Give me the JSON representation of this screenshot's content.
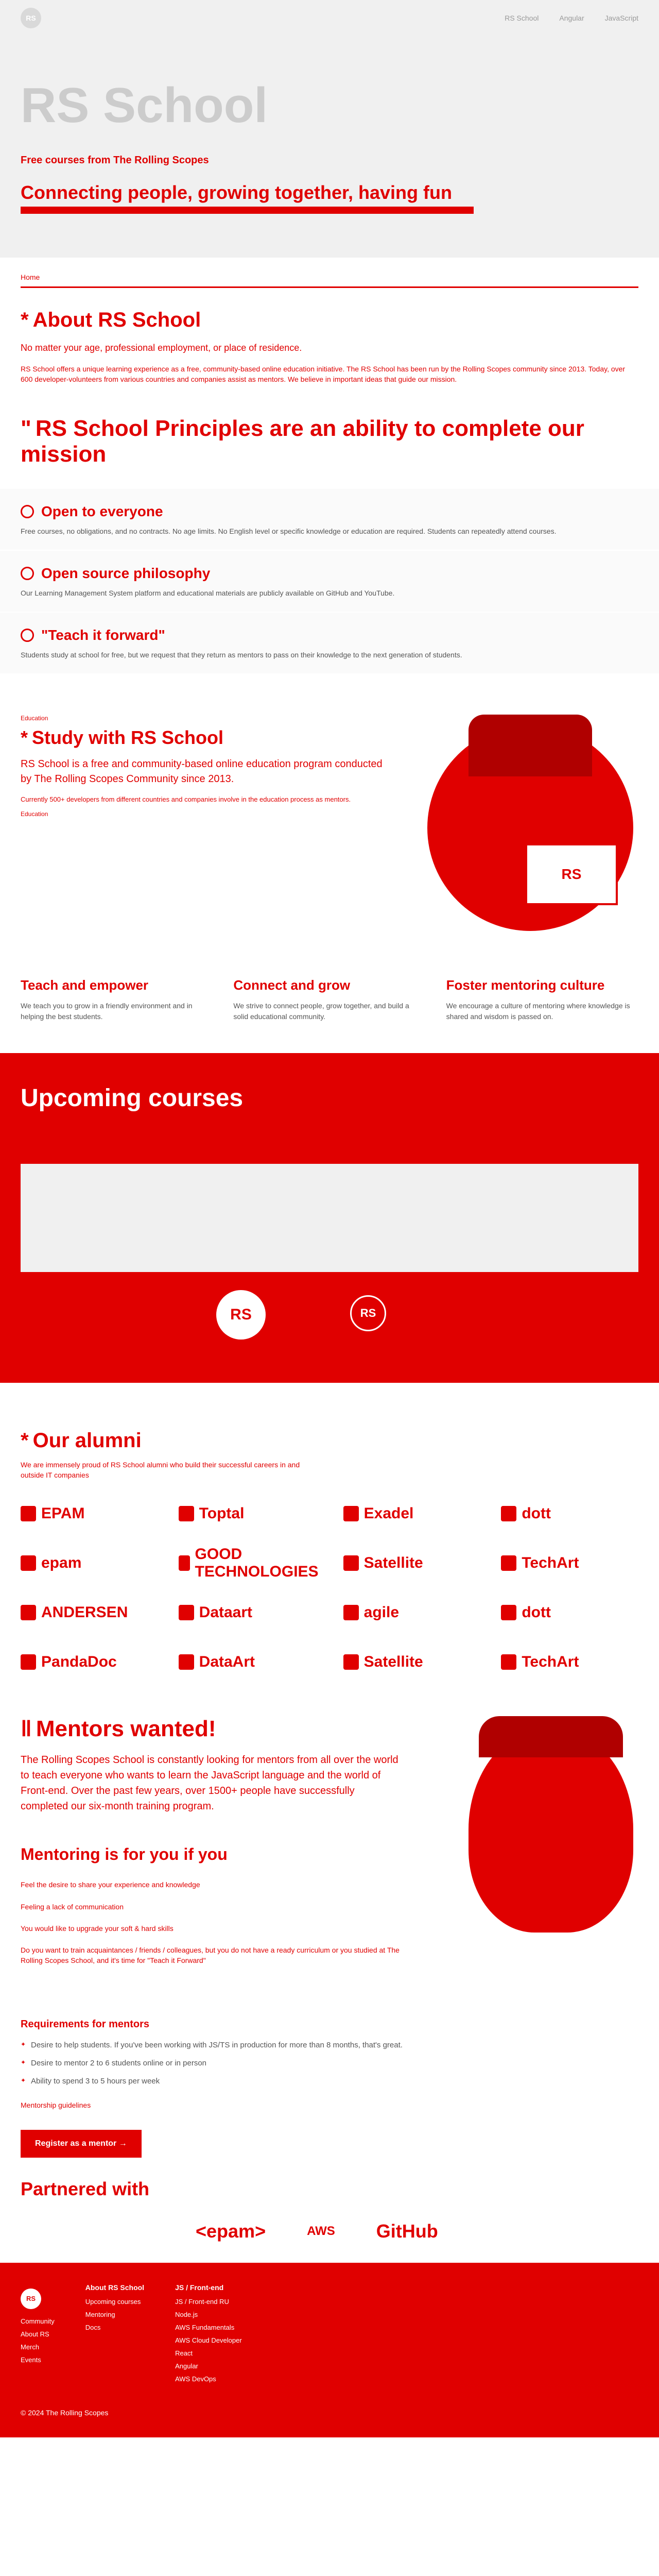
{
  "nav": {
    "logo": "RS",
    "links": [
      "RS School",
      "Angular",
      "JavaScript"
    ]
  },
  "hero": {
    "title": "RS School",
    "subtitle": "Free courses from The Rolling Scopes",
    "tagline": "Connecting people, growing together, having fun"
  },
  "breadcrumb": {
    "home": "Home"
  },
  "about": {
    "title": "About RS School",
    "lead": "No matter your age, professional employment, or place of residence.",
    "body": "RS School offers a unique learning experience as a free, community-based online education initiative. The RS School has been run by the Rolling Scopes community since 2013. Today, over 600 developer-volunteers from various countries and companies assist as mentors. We believe in important ideas that guide our mission."
  },
  "principles": {
    "title": "RS School Principles are an ability to complete our mission",
    "items": [
      {
        "title": "Open to everyone",
        "desc": "Free courses, no obligations, and no contracts. No age limits. No English level or specific knowledge or education are required. Students can repeatedly attend courses."
      },
      {
        "title": "Open source philosophy",
        "desc": "Our Learning Management System platform and educational materials are publicly available on GitHub and YouTube."
      },
      {
        "title": "\"Teach it forward\"",
        "desc": "Students study at school for free, but we request that they return as mentors to pass on their knowledge to the next generation of students."
      }
    ]
  },
  "study": {
    "label": "Education",
    "title": "Study with RS School",
    "lead": "RS School is a free and community-based online education program conducted by The Rolling Scopes Community since 2013.",
    "body": "Currently 500+ developers from different countries and companies involve in the education process as mentors.",
    "extra": "Education",
    "laptop": "RS"
  },
  "pillars": [
    {
      "title": "Teach and empower",
      "desc": "We teach you to grow in a friendly environment and in helping the best students."
    },
    {
      "title": "Connect and grow",
      "desc": "We strive to connect people, grow together, and build a solid educational community."
    },
    {
      "title": "Foster mentoring culture",
      "desc": "We encourage a culture of mentoring where knowledge is shared and wisdom is passed on."
    }
  ],
  "courses": {
    "title": "Upcoming courses",
    "badge_big": "RS",
    "badge_small": "RS"
  },
  "alumni": {
    "title": "Our alumni",
    "desc": "We are immensely proud of RS School alumni who build their successful careers in and outside IT companies",
    "logos": [
      "EPAM",
      "Toptal",
      "Exadel",
      "dott",
      "epam",
      "GOOD TECHNOLOGIES",
      "Satellite",
      "TechArt",
      "ANDERSEN",
      "Dataart",
      "agile",
      "dott",
      "PandaDoc",
      "DataArt",
      "Satellite",
      "TechArt"
    ]
  },
  "mentors": {
    "title": "Mentors wanted!",
    "body": "The Rolling Scopes School is constantly looking for mentors from all over the world to teach everyone who wants to learn the JavaScript language and the world of Front-end. Over the past few years, over 1500+ people have successfully completed our six-month training program.",
    "for_you_title": "Mentoring is for you if you",
    "reasons": [
      "Feel the desire to share your experience and knowledge",
      "Feeling a lack of communication",
      "You would like to upgrade your soft & hard skills",
      "Do you want to train acquaintances / friends / colleagues, but you do not have a ready curriculum or you studied at The Rolling Scopes School, and it's time for \"Teach it Forward\""
    ],
    "req_title": "Requirements for mentors",
    "requirements": [
      "Desire to help students. If you've been working with JS/TS in production for more than 8 months, that's great.",
      "Desire to mentor 2 to 6 students online or in person",
      "Ability to spend 3 to 5 hours per week"
    ],
    "faq": "Mentorship guidelines",
    "btn": "Register as a mentor →"
  },
  "partners": {
    "title": "Partnered with",
    "items": [
      "<epam>",
      "AWS",
      "GitHub"
    ]
  },
  "footer": {
    "logo": "RS",
    "community_label": "Community",
    "about_label": "About RS",
    "merch_label": "Merch",
    "events_label": "Events",
    "col1_title": "About RS School",
    "col1_items": [
      "Upcoming courses",
      "Mentoring",
      "Docs"
    ],
    "col2_title": "JS / Front-end",
    "col2_items": [
      "JS / Front-end RU",
      "Node.js",
      "AWS Fundamentals",
      "AWS Cloud Developer",
      "React",
      "Angular",
      "AWS DevOps"
    ],
    "copyright": "© 2024 The Rolling Scopes"
  }
}
